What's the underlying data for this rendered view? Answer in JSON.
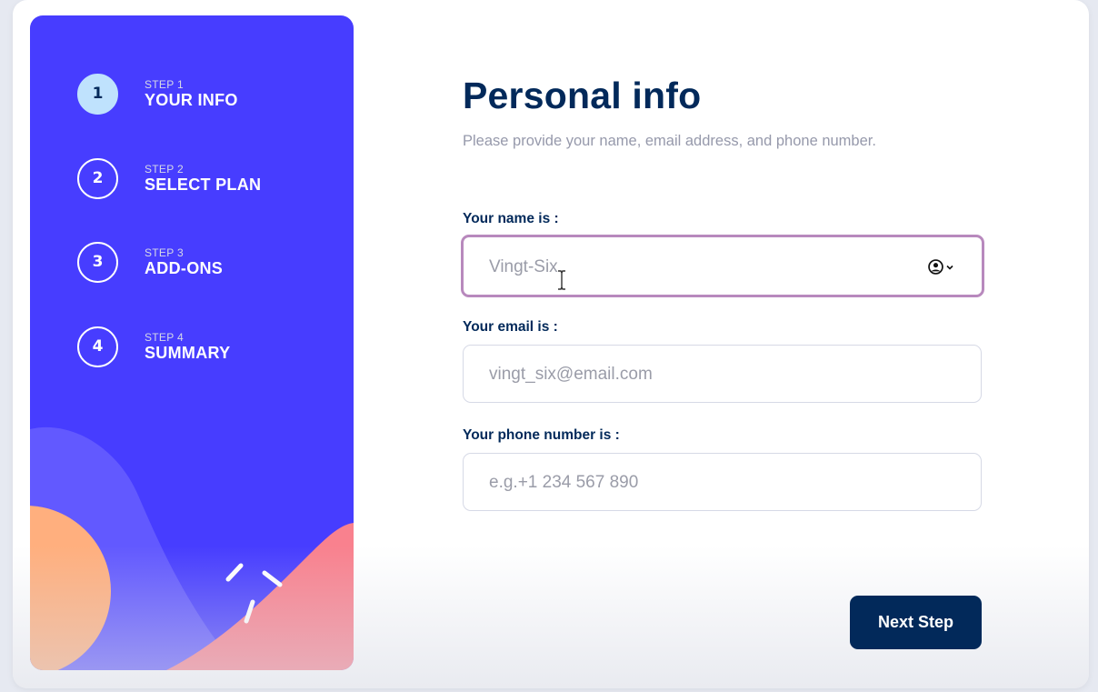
{
  "sidebar": {
    "steps": [
      {
        "number": "1",
        "small": "STEP 1",
        "big": "YOUR INFO",
        "active": true
      },
      {
        "number": "2",
        "small": "STEP 2",
        "big": "SELECT PLAN",
        "active": false
      },
      {
        "number": "3",
        "small": "STEP 3",
        "big": "ADD-ONS",
        "active": false
      },
      {
        "number": "4",
        "small": "STEP 4",
        "big": "SUMMARY",
        "active": false
      }
    ]
  },
  "main": {
    "title": "Personal info",
    "subtitle": "Please provide your name, email address, and phone number.",
    "name": {
      "label": "Your name is :",
      "placeholder": "Vingt-Six",
      "autofill_icon": "contact-autofill-icon"
    },
    "email": {
      "label": "Your email is :",
      "placeholder": "vingt_six@email.com"
    },
    "phone": {
      "label": "Your phone number is :",
      "placeholder": "e.g.+1 234 567 890"
    },
    "next_label": "Next Step"
  },
  "colors": {
    "sidebar_bg": "#473dff",
    "active_step": "#bfe2fd",
    "denim": "#02295a",
    "focus_border": "#b889bd",
    "orange": "#ffaf7e",
    "pink": "#f9818e"
  }
}
